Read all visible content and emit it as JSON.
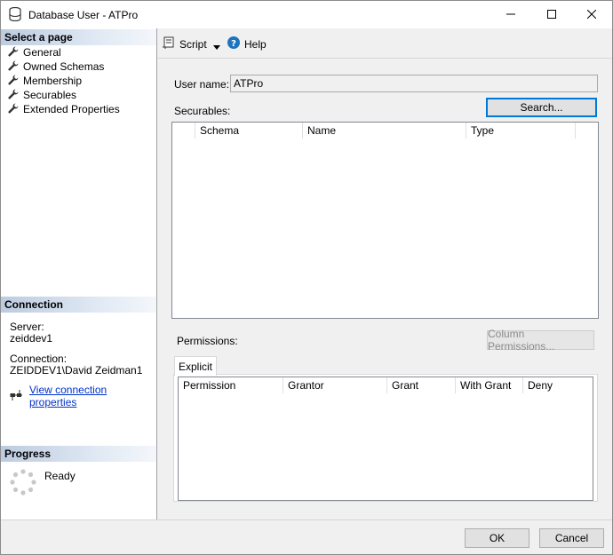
{
  "window": {
    "title": "Database User - ATPro",
    "icon": "database-icon",
    "controls": [
      "minimize-icon",
      "maximize-icon",
      "close-icon"
    ]
  },
  "left_pane": {
    "select_page_header": "Select a page",
    "pages": [
      {
        "label": "General",
        "icon": "wrench-icon"
      },
      {
        "label": "Owned Schemas",
        "icon": "wrench-icon"
      },
      {
        "label": "Membership",
        "icon": "wrench-icon"
      },
      {
        "label": "Securables",
        "icon": "wrench-icon"
      },
      {
        "label": "Extended Properties",
        "icon": "wrench-icon"
      }
    ],
    "connection_header": "Connection",
    "server_label": "Server:",
    "server_value": "zeiddev1",
    "connection_label": "Connection:",
    "connection_value": "ZEIDDEV1\\David Zeidman1",
    "view_connection_link": "View connection properties",
    "progress_header": "Progress",
    "progress_status": "Ready"
  },
  "toolbar": {
    "script_label": "Script",
    "help_label": "Help"
  },
  "main": {
    "user_name_label": "User name:",
    "user_name_value": "ATPro",
    "securables_label": "Securables:",
    "search_button": "Search...",
    "securables_columns": [
      "Schema",
      "Name",
      "Type"
    ],
    "permissions_label": "Permissions:",
    "column_permissions_button": "Column Permissions...",
    "tab_explicit": "Explicit",
    "permissions_columns": [
      "Permission",
      "Grantor",
      "Grant",
      "With Grant",
      "Deny"
    ]
  },
  "footer": {
    "ok_button": "OK",
    "cancel_button": "Cancel"
  },
  "colors": {
    "link": "#0033cc",
    "default_button_border": "#0078d7",
    "section_header": "#bccbe0"
  }
}
